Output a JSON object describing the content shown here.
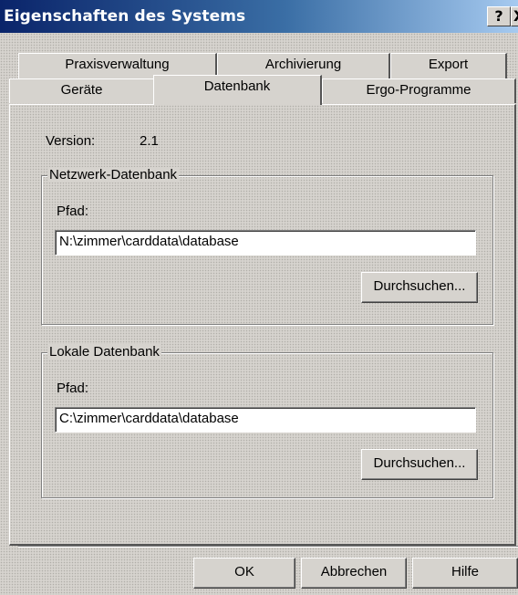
{
  "window": {
    "title": "Eigenschaften des Systems",
    "help_button": "?",
    "close_button": "X"
  },
  "tabs": {
    "row_back": [
      {
        "label": "Praxisverwaltung"
      },
      {
        "label": "Archivierung"
      },
      {
        "label": "Export"
      }
    ],
    "row_front": [
      {
        "label": "Geräte"
      },
      {
        "label": "Datenbank",
        "active": true
      },
      {
        "label": "Ergo-Programme"
      }
    ]
  },
  "panel": {
    "version_label": "Version:",
    "version_value": "2.1",
    "network_db": {
      "title": "Netzwerk-Datenbank",
      "path_label": "Pfad:",
      "path_value": "N:\\zimmer\\carddata\\database",
      "browse_button": "Durchsuchen..."
    },
    "local_db": {
      "title": "Lokale Datenbank",
      "path_label": "Pfad:",
      "path_value": "C:\\zimmer\\carddata\\database",
      "browse_button": "Durchsuchen..."
    }
  },
  "footer": {
    "ok_button": "OK",
    "cancel_button": "Abbrechen",
    "help_button": "Hilfe"
  },
  "colors": {
    "face": "#d6d3ce",
    "title_start": "#0a246a",
    "title_end": "#a6caf0"
  }
}
